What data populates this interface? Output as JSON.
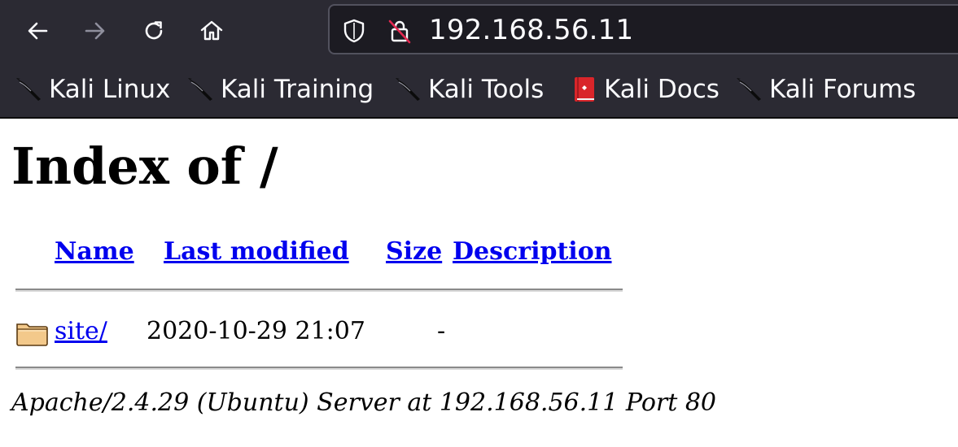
{
  "browser": {
    "url": "192.168.56.11",
    "nav": {
      "back_icon": "arrow-left-icon",
      "forward_icon": "arrow-right-icon",
      "reload_icon": "reload-icon",
      "home_icon": "home-icon"
    },
    "bookmarks": [
      {
        "label": "Kali Linux",
        "icon": "kali-dragon-icon"
      },
      {
        "label": "Kali Training",
        "icon": "kali-dragon-icon"
      },
      {
        "label": "Kali Tools",
        "icon": "kali-dragon-icon"
      },
      {
        "label": "Kali Docs",
        "icon": "kali-docs-book-icon"
      },
      {
        "label": "Kali Forums",
        "icon": "kali-dragon-icon"
      }
    ],
    "colors": {
      "chrome": "#2b2a33",
      "urlbar": "#1c1b22",
      "text": "#fbfbfe"
    }
  },
  "page": {
    "title": "Index of /",
    "columns": [
      "Name",
      "Last modified",
      "Size",
      "Description"
    ],
    "rows": [
      {
        "icon": "folder-icon",
        "name": "site/",
        "modified": "2020-10-29 21:07",
        "size": "-",
        "description": ""
      }
    ],
    "address": "Apache/2.4.29 (Ubuntu) Server at 192.168.56.11 Port 80",
    "colors": {
      "link": "#0000ee",
      "text": "#000000"
    }
  }
}
